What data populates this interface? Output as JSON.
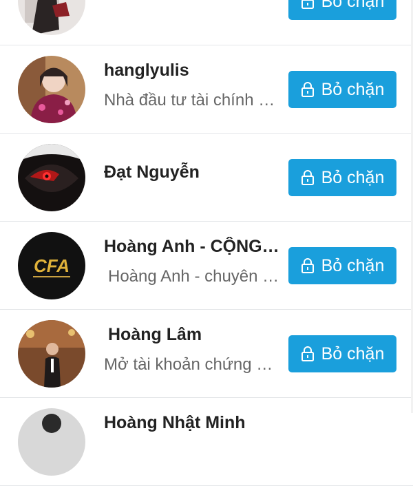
{
  "blocked_list": {
    "button_label": "Bỏ chặn",
    "rows": [
      {
        "name": "",
        "subtitle": ""
      },
      {
        "name": "hanglyulis",
        "subtitle": "Nhà đầu tư tài chính chuyên nghiệp"
      },
      {
        "name": "Đạt Nguyễn",
        "subtitle": ""
      },
      {
        "name": "Hoàng Anh - CỘNG ĐỒNG CFA",
        "subtitle": "Hoàng Anh - chuyên gia tài chính"
      },
      {
        "name": "Hoàng Lâm",
        "subtitle": "Mở tài khoản chứng khoán"
      },
      {
        "name": "Hoàng Nhật Minh",
        "subtitle": ""
      }
    ],
    "logo_text": "CFA"
  },
  "colors": {
    "button": "#1a9fdc",
    "name": "#222222",
    "subtitle": "#666666"
  },
  "icons": [
    "lock-icon"
  ]
}
